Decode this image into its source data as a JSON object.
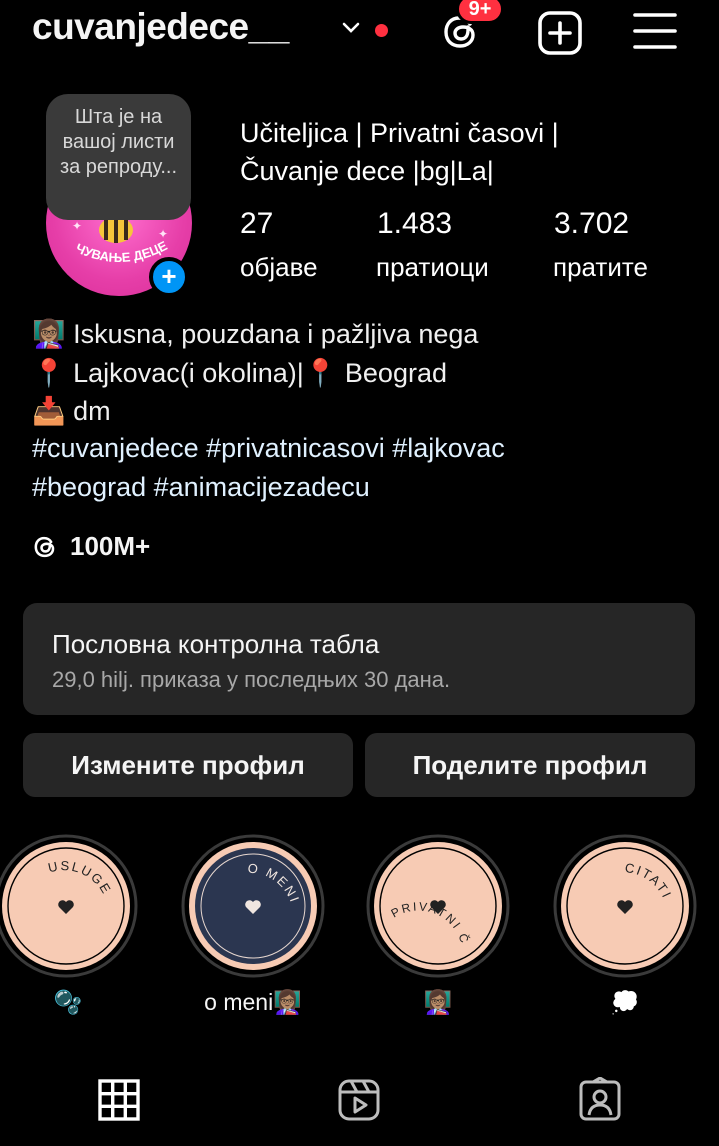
{
  "header": {
    "username": "cuvanjedece__",
    "badge": "9+",
    "icons": [
      "chevron-down-icon",
      "threads-icon",
      "create-icon",
      "menu-icon"
    ],
    "accent_red": "#ff3040"
  },
  "profile": {
    "note": "Шта је на вашој листи за репроду...",
    "avatar_text": "ЧУВАЊЕ ДЕЦЕ",
    "display_name": "Učiteljica | Privatni časovi | Čuvanje dece |bg|La|",
    "stats": [
      {
        "value": "27",
        "label": "објаве"
      },
      {
        "value": "1.483",
        "label": "пратиоци"
      },
      {
        "value": "3.702",
        "label": "пратите"
      }
    ]
  },
  "bio": {
    "line1_emoji": "👩🏽‍🏫",
    "line1": "Iskusna, pouzdana i pažljiva nega",
    "line2_emoji1": "📍",
    "line2a": "Lajkovac(i okolina)|",
    "line2_emoji2": "📍",
    "line2b": "Beograd",
    "line3_emoji": "📥",
    "line3": "dm",
    "hashtags1": "#cuvanjedece #privatnicasovi #lajkovac",
    "hashtags2": "#beograd #animacijezadecu",
    "threads_count": "100M+"
  },
  "dashboard": {
    "title": "Пословна контролна табла",
    "subtitle": "29,0 hilj. приказа у последњих 30 дана."
  },
  "buttons": {
    "edit": "Измените профил",
    "share": "Поделите профил"
  },
  "highlights": [
    {
      "cover_text": "USLUGE",
      "label": "🫧",
      "cover_color": "#f7cbb4"
    },
    {
      "cover_text": "O MENI",
      "label": "o meni👩🏽‍🏫",
      "cover_color": "#2b3650"
    },
    {
      "cover_text": "PRIVATNI ČASOVI",
      "label": "👩🏽‍🏫",
      "cover_color": "#f7cbb4"
    },
    {
      "cover_text": "CITATI",
      "label": "💭",
      "cover_color": "#f7cbb4"
    }
  ],
  "tabs": [
    "grid-icon",
    "reels-icon",
    "tagged-icon"
  ]
}
